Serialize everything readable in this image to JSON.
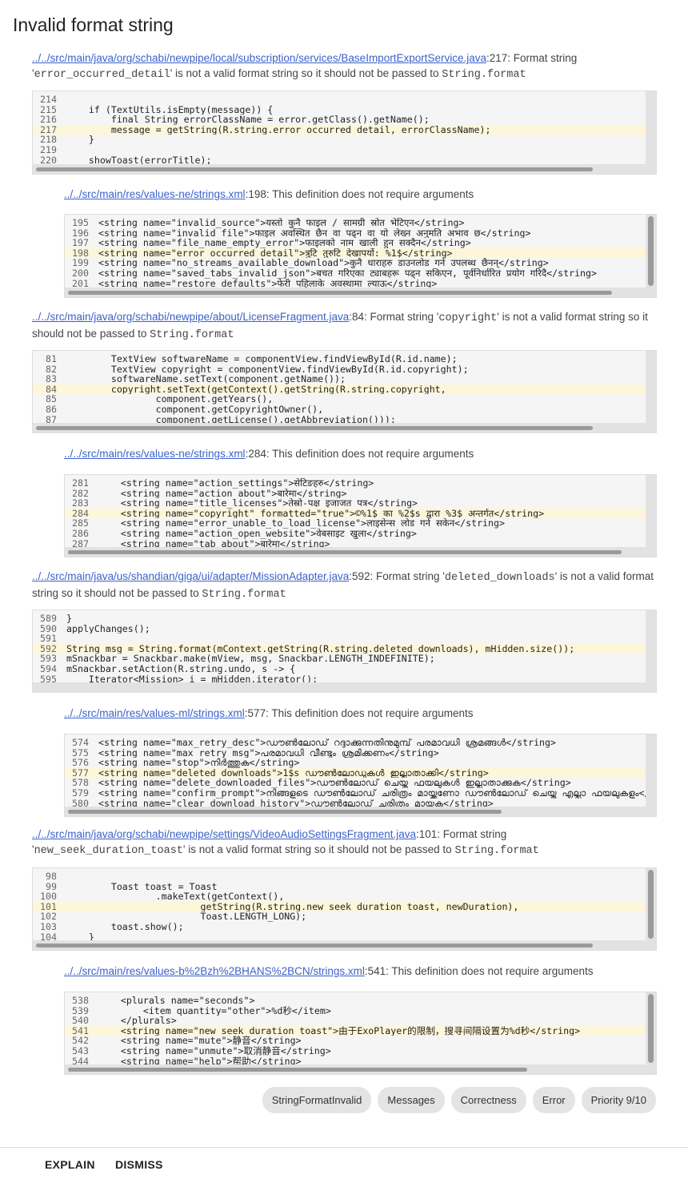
{
  "page_title": "Invalid format string",
  "issues": [
    {
      "link": "../../src/main/java/org/schabi/newpipe/local/subscription/services/BaseImportExportService.java",
      "line_suffix": ":217: Format string '",
      "identifier": "error_occurred_detail",
      "message_tail": "' is not a valid format string so it should not be passed to ",
      "target": "String.format",
      "code": [
        {
          "n": "214",
          "t": ""
        },
        {
          "n": "215",
          "t": "    if (TextUtils.isEmpty(message)) {"
        },
        {
          "n": "216",
          "t": "        final String errorClassName = error.getClass().getName();"
        },
        {
          "n": "217",
          "t": "        message = getString(R.string.error_occurred_detail, errorClassName);"
        },
        {
          "n": "218",
          "t": "    }"
        },
        {
          "n": "219",
          "t": ""
        },
        {
          "n": "220",
          "t": "    showToast(errorTitle);"
        }
      ]
    },
    {
      "link": "../../src/main/res/values-ne/strings.xml",
      "suffix": ":198: This definition does not require arguments",
      "code": [
        {
          "n": "195",
          "t": "<string name=\"invalid_source\">यस्तो कुनै फाइल / सामग्री स्रोत भेटिएन</string>"
        },
        {
          "n": "196",
          "t": "<string name=\"invalid_file\">फाइल अवस्थित छैन वा पढ्न वा यो लेख्न अनुमति अभाव छ</string>"
        },
        {
          "n": "197",
          "t": "<string name=\"file_name_empty_error\">फाइलको नाम खाली हुन सक्दैन</string>"
        },
        {
          "n": "198",
          "t": "<string name=\"error_occurred_detail\">त्रुटि तुरुटि देखापर्यो: %1$</string>"
        },
        {
          "n": "199",
          "t": "<string name=\"no_streams_available_download\">कुनै धाराहरु डाउनलोड गर्न उपलब्ध छैनन्</string>"
        },
        {
          "n": "200",
          "t": "<string name=\"saved_tabs_invalid_json\">बचत गरिएका ट्याबहरू पढ्न सकिएन, पूर्वनिर्धारित प्रयोग गरिदै</string>"
        },
        {
          "n": "201",
          "t": "<string name=\"restore_defaults\">फेरी पहिलाके अवस्थामा ल्याऊ</string>"
        }
      ]
    },
    {
      "link": "../../src/main/java/org/schabi/newpipe/about/LicenseFragment.java",
      "line_suffix": ":84: Format string '",
      "identifier": "copyright",
      "message_tail": "' is not a valid format string so it should not be passed to ",
      "target": "String.format",
      "code": [
        {
          "n": "81",
          "t": "        TextView softwareName = componentView.findViewById(R.id.name);"
        },
        {
          "n": "82",
          "t": "        TextView copyright = componentView.findViewById(R.id.copyright);"
        },
        {
          "n": "83",
          "t": "        softwareName.setText(component.getName());"
        },
        {
          "n": "84",
          "t": "        copyright.setText(getContext().getString(R.string.copyright,"
        },
        {
          "n": "85",
          "t": "                component.getYears(),"
        },
        {
          "n": "86",
          "t": "                component.getCopyrightOwner(),"
        },
        {
          "n": "87",
          "t": "                component.getLicense().getAbbreviation()));"
        }
      ]
    },
    {
      "link": "../../src/main/res/values-ne/strings.xml",
      "suffix": ":284: This definition does not require arguments",
      "code": [
        {
          "n": "281",
          "t": "    <string name=\"action_settings\">सेटिङहरु</string>"
        },
        {
          "n": "282",
          "t": "    <string name=\"action_about\">बारेमा</string>"
        },
        {
          "n": "283",
          "t": "    <string name=\"title_licenses\">तेस्रो-पक्ष इजाजत पत्र</string>"
        },
        {
          "n": "284",
          "t": "    <string name=\"copyright\" formatted=\"true\">©%1$ का %2$s द्वारा %3$ अन्तर्गत</string>"
        },
        {
          "n": "285",
          "t": "    <string name=\"error_unable_to_load_license\">लाइसेन्स लोड गर्न सकेन</string>"
        },
        {
          "n": "286",
          "t": "    <string name=\"action_open_website\">वेबसाइट खुला</string>"
        },
        {
          "n": "287",
          "t": "    <string name=\"tab_about\">बारेमा</string>"
        }
      ]
    },
    {
      "link": "../../src/main/java/us/shandian/giga/ui/adapter/MissionAdapter.java",
      "line_suffix": ":592: Format string '",
      "identifier": "deleted_downloads",
      "message_tail": "' is not a valid format string so it should not be passed to ",
      "target": "String.format",
      "code": [
        {
          "n": "589",
          "t": "}"
        },
        {
          "n": "590",
          "t": "applyChanges();"
        },
        {
          "n": "591",
          "t": ""
        },
        {
          "n": "592",
          "t": "String msg = String.format(mContext.getString(R.string.deleted_downloads), mHidden.size());"
        },
        {
          "n": "593",
          "t": "mSnackbar = Snackbar.make(mView, msg, Snackbar.LENGTH_INDEFINITE);"
        },
        {
          "n": "594",
          "t": "mSnackbar.setAction(R.string.undo, s -> {"
        },
        {
          "n": "595",
          "t": "    Iterator<Mission> i = mHidden.iterator();"
        }
      ]
    },
    {
      "link": "../../src/main/res/values-ml/strings.xml",
      "suffix": ":577: This definition does not require arguments",
      "code": [
        {
          "n": "574",
          "t": "<string name=\"max_retry_desc\">ഡൗൺലോഡ് റദ്ദാക്കുന്നതിനുമുമ്പ് പരമാവധി ശ്രമങ്ങൾ</string>"
        },
        {
          "n": "575",
          "t": "<string name=\"max_retry_msg\">പരമാവധി വീണ്ടും ശ്രമിക്കണം</string>"
        },
        {
          "n": "576",
          "t": "<string name=\"stop\">നിർത്തുക</string>"
        },
        {
          "n": "577",
          "t": "<string name=\"deleted_downloads\">1$s ഡൗൺലോഡുകൾ ഇല്ലാതാക്കി</string>"
        },
        {
          "n": "578",
          "t": "<string name=\"delete_downloaded_files\">ഡൗൺലോഡ് ചെയ്ത ഫയലുകൾ ഇല്ലാതാക്കുക</string>"
        },
        {
          "n": "579",
          "t": "<string name=\"confirm_prompt\">നിങ്ങളുടെ ഡൗൺലോഡ് ചരിത്രം മായ്ക്കണോ ഡൗൺലോഡ് ചെയ്ത എല്ലാ ഫയലുകളും</string>"
        },
        {
          "n": "580",
          "t": "<string name=\"clear_download_history\">ഡൗൺലോഡ് ചരിത്രം മായ്ക്കുക</string>"
        }
      ]
    },
    {
      "link": "../../src/main/java/org/schabi/newpipe/settings/VideoAudioSettingsFragment.java",
      "line_suffix": ":101: Format string '",
      "identifier": "new_seek_duration_toast",
      "message_tail": "' is not a valid format string so it should not be passed to ",
      "target": "String.format",
      "code": [
        {
          "n": "98",
          "t": ""
        },
        {
          "n": "99",
          "t": "        Toast toast = Toast"
        },
        {
          "n": "100",
          "t": "                .makeText(getContext(),"
        },
        {
          "n": "101",
          "t": "                        getString(R.string.new_seek_duration_toast, newDuration),"
        },
        {
          "n": "102",
          "t": "                        Toast.LENGTH_LONG);"
        },
        {
          "n": "103",
          "t": "        toast.show();"
        },
        {
          "n": "104",
          "t": "    }"
        }
      ]
    },
    {
      "link": "../../src/main/res/values-b%2Bzh%2BHANS%2BCN/strings.xml",
      "suffix": ":541: This definition does not require arguments",
      "code": [
        {
          "n": "538",
          "t": "    <plurals name=\"seconds\">"
        },
        {
          "n": "539",
          "t": "        <item quantity=\"other\">%d秒</item>"
        },
        {
          "n": "540",
          "t": "    </plurals>"
        },
        {
          "n": "541",
          "t": "    <string name=\"new_seek_duration_toast\">由于ExoPlayer的限制，搜寻间隔设置为%d秒</string>"
        },
        {
          "n": "542",
          "t": "    <string name=\"mute\">静音</string>"
        },
        {
          "n": "543",
          "t": "    <string name=\"unmute\">取消静音</string>"
        },
        {
          "n": "544",
          "t": "    <string name=\"help\">帮助</string>"
        }
      ]
    }
  ],
  "chips": [
    "StringFormatInvalid",
    "Messages",
    "Correctness",
    "Error",
    "Priority 9/10"
  ],
  "actions": {
    "explain": "EXPLAIN",
    "dismiss": "DISMISS"
  }
}
